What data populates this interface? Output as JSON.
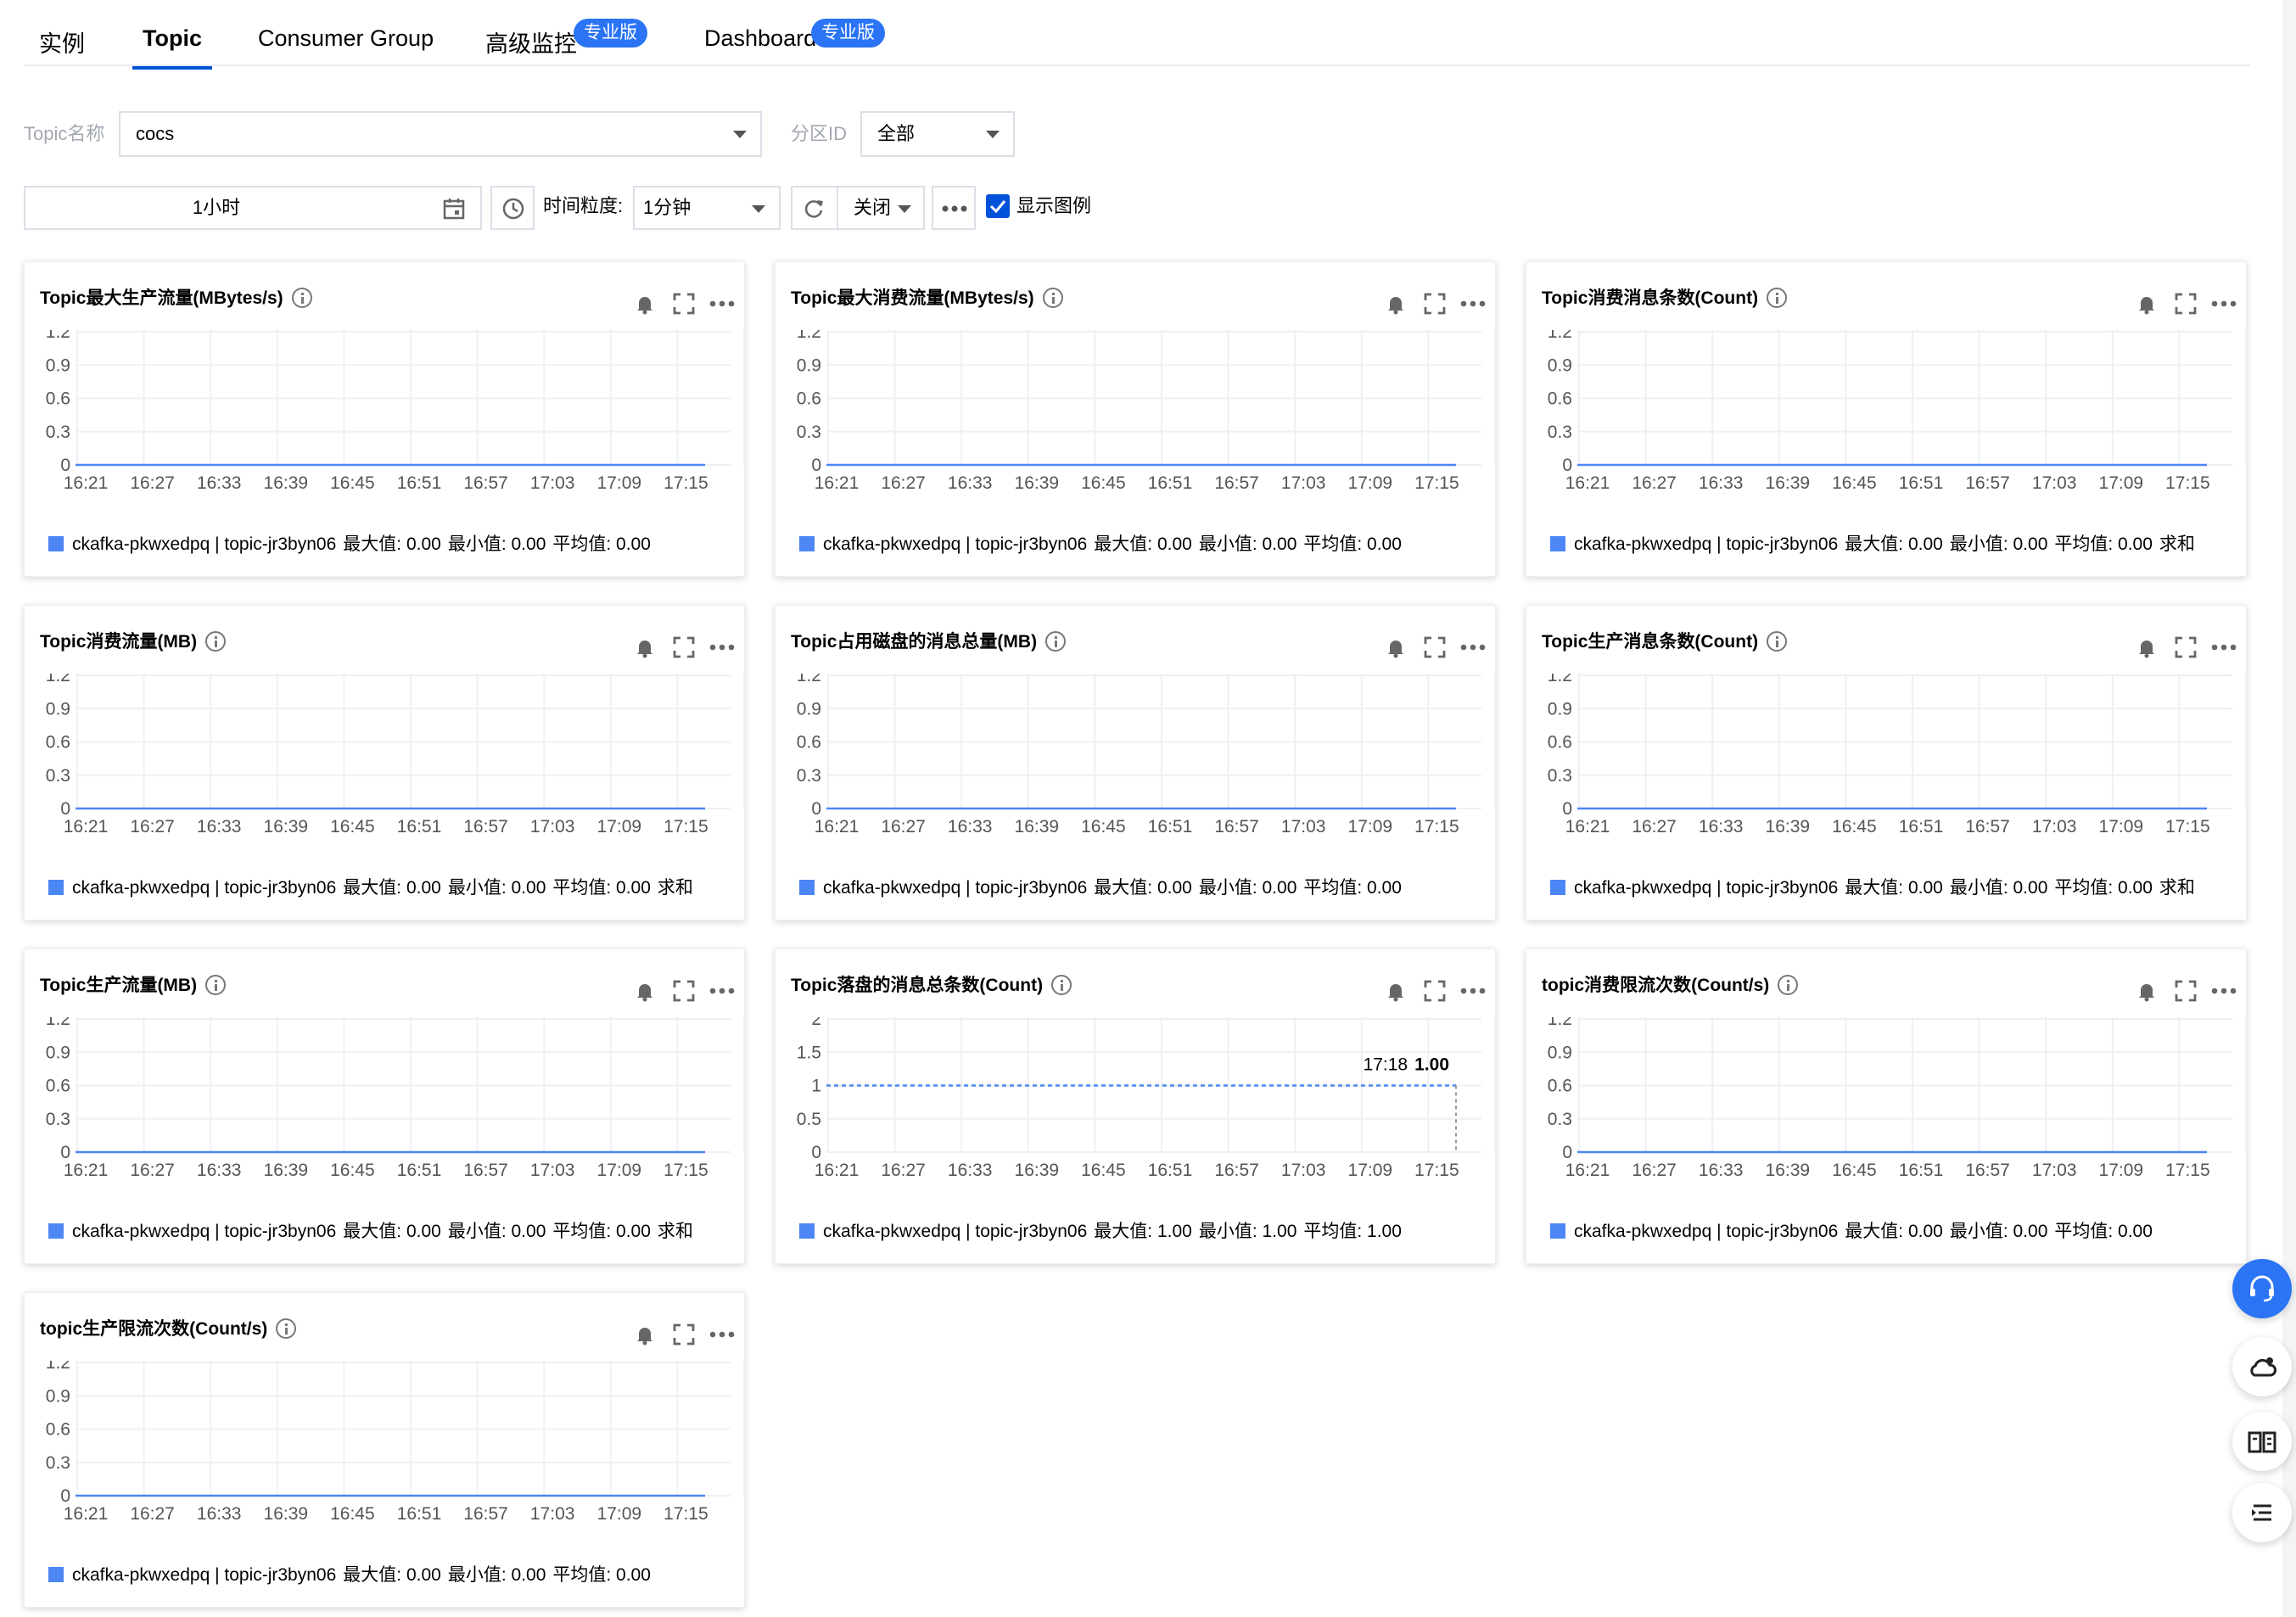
{
  "tabs": [
    {
      "label": "实例",
      "active": false
    },
    {
      "label": "Topic",
      "active": true
    },
    {
      "label": "Consumer Group",
      "active": false
    },
    {
      "label": "高级监控",
      "active": false,
      "badge": "专业版"
    },
    {
      "label": "Dashboard",
      "active": false,
      "badge": "专业版"
    }
  ],
  "filters": {
    "topic_label": "Topic名称",
    "topic_value": "cocs",
    "partition_label": "分区ID",
    "partition_value": "全部"
  },
  "toolbar": {
    "time_range": "1小时",
    "granularity_label": "时间粒度:",
    "granularity_value": "1分钟",
    "refresh_value": "关闭",
    "show_legend_label": "显示图例",
    "show_legend_checked": true
  },
  "accent_color": "#0052d9",
  "series_color": "#4d86f5",
  "icons": [
    "calendar-icon",
    "clock-icon",
    "refresh-icon",
    "more-icon",
    "bell-icon",
    "fullscreen-icon",
    "info-icon",
    "headset-icon",
    "cloud-icon",
    "book-icon",
    "list-icon"
  ],
  "chart_data": [
    {
      "type": "line",
      "title": "Topic最大生产流量(MBytes/s)",
      "x": [
        "16:21",
        "16:27",
        "16:33",
        "16:39",
        "16:45",
        "16:51",
        "16:57",
        "17:03",
        "17:09",
        "17:15"
      ],
      "yticks": [
        "1.2",
        "0.9",
        "0.6",
        "0.3",
        "0"
      ],
      "ylim": [
        0,
        1.2
      ],
      "series": [
        {
          "name": "ckafka-pkwxedpq | topic-jr3byn06",
          "values": [
            0,
            0,
            0,
            0,
            0,
            0,
            0,
            0,
            0,
            0,
            0
          ]
        }
      ],
      "legend": {
        "max": "最大值: 0.00",
        "min": "最小值: 0.00",
        "avg": "平均值: 0.00"
      }
    },
    {
      "type": "line",
      "title": "Topic最大消费流量(MBytes/s)",
      "x": [
        "16:21",
        "16:27",
        "16:33",
        "16:39",
        "16:45",
        "16:51",
        "16:57",
        "17:03",
        "17:09",
        "17:15"
      ],
      "yticks": [
        "1.2",
        "0.9",
        "0.6",
        "0.3",
        "0"
      ],
      "ylim": [
        0,
        1.2
      ],
      "series": [
        {
          "name": "ckafka-pkwxedpq | topic-jr3byn06",
          "values": [
            0,
            0,
            0,
            0,
            0,
            0,
            0,
            0,
            0,
            0,
            0
          ]
        }
      ],
      "legend": {
        "max": "最大值: 0.00",
        "min": "最小值: 0.00",
        "avg": "平均值: 0.00"
      }
    },
    {
      "type": "line",
      "title": "Topic消费消息条数(Count)",
      "x": [
        "16:21",
        "16:27",
        "16:33",
        "16:39",
        "16:45",
        "16:51",
        "16:57",
        "17:03",
        "17:09",
        "17:15"
      ],
      "yticks": [
        "1.2",
        "0.9",
        "0.6",
        "0.3",
        "0"
      ],
      "ylim": [
        0,
        1.2
      ],
      "series": [
        {
          "name": "ckafka-pkwxedpq | topic-jr3byn06",
          "values": [
            0,
            0,
            0,
            0,
            0,
            0,
            0,
            0,
            0,
            0,
            0
          ]
        }
      ],
      "legend": {
        "max": "最大值: 0.00",
        "min": "最小值: 0.00",
        "avg": "平均值: 0.00",
        "sum": "求和"
      }
    },
    {
      "type": "line",
      "title": "Topic消费流量(MB)",
      "x": [
        "16:21",
        "16:27",
        "16:33",
        "16:39",
        "16:45",
        "16:51",
        "16:57",
        "17:03",
        "17:09",
        "17:15"
      ],
      "yticks": [
        "1.2",
        "0.9",
        "0.6",
        "0.3",
        "0"
      ],
      "ylim": [
        0,
        1.2
      ],
      "series": [
        {
          "name": "ckafka-pkwxedpq | topic-jr3byn06",
          "values": [
            0,
            0,
            0,
            0,
            0,
            0,
            0,
            0,
            0,
            0,
            0
          ]
        }
      ],
      "legend": {
        "max": "最大值: 0.00",
        "min": "最小值: 0.00",
        "avg": "平均值: 0.00",
        "sum": "求和"
      }
    },
    {
      "type": "line",
      "title": "Topic占用磁盘的消息总量(MB)",
      "x": [
        "16:21",
        "16:27",
        "16:33",
        "16:39",
        "16:45",
        "16:51",
        "16:57",
        "17:03",
        "17:09",
        "17:15"
      ],
      "yticks": [
        "1.2",
        "0.9",
        "0.6",
        "0.3",
        "0"
      ],
      "ylim": [
        0,
        1.2
      ],
      "series": [
        {
          "name": "ckafka-pkwxedpq | topic-jr3byn06",
          "values": [
            0,
            0,
            0,
            0,
            0,
            0,
            0,
            0,
            0,
            0,
            0
          ]
        }
      ],
      "legend": {
        "max": "最大值: 0.00",
        "min": "最小值: 0.00",
        "avg": "平均值: 0.00"
      }
    },
    {
      "type": "line",
      "title": "Topic生产消息条数(Count)",
      "x": [
        "16:21",
        "16:27",
        "16:33",
        "16:39",
        "16:45",
        "16:51",
        "16:57",
        "17:03",
        "17:09",
        "17:15"
      ],
      "yticks": [
        "1.2",
        "0.9",
        "0.6",
        "0.3",
        "0"
      ],
      "ylim": [
        0,
        1.2
      ],
      "series": [
        {
          "name": "ckafka-pkwxedpq | topic-jr3byn06",
          "values": [
            0,
            0,
            0,
            0,
            0,
            0,
            0,
            0,
            0,
            0,
            0
          ]
        }
      ],
      "legend": {
        "max": "最大值: 0.00",
        "min": "最小值: 0.00",
        "avg": "平均值: 0.00",
        "sum": "求和"
      }
    },
    {
      "type": "line",
      "title": "Topic生产流量(MB)",
      "x": [
        "16:21",
        "16:27",
        "16:33",
        "16:39",
        "16:45",
        "16:51",
        "16:57",
        "17:03",
        "17:09",
        "17:15"
      ],
      "yticks": [
        "1.2",
        "0.9",
        "0.6",
        "0.3",
        "0"
      ],
      "ylim": [
        0,
        1.2
      ],
      "series": [
        {
          "name": "ckafka-pkwxedpq | topic-jr3byn06",
          "values": [
            0,
            0,
            0,
            0,
            0,
            0,
            0,
            0,
            0,
            0,
            0
          ]
        }
      ],
      "legend": {
        "max": "最大值: 0.00",
        "min": "最小值: 0.00",
        "avg": "平均值: 0.00",
        "sum": "求和"
      }
    },
    {
      "type": "line",
      "title": "Topic落盘的消息总条数(Count)",
      "x": [
        "16:21",
        "16:27",
        "16:33",
        "16:39",
        "16:45",
        "16:51",
        "16:57",
        "17:03",
        "17:09",
        "17:15"
      ],
      "yticks": [
        "2",
        "1.5",
        "1",
        "0.5",
        "0"
      ],
      "ylim": [
        0,
        2
      ],
      "series": [
        {
          "name": "ckafka-pkwxedpq | topic-jr3byn06",
          "values": [
            1,
            1,
            1,
            1,
            1,
            1,
            1,
            1,
            1,
            1,
            1
          ],
          "dashed": true
        }
      ],
      "tooltip": {
        "time": "17:18",
        "value": "1.00"
      },
      "legend": {
        "max": "最大值: 1.00",
        "min": "最小值: 1.00",
        "avg": "平均值: 1.00"
      }
    },
    {
      "type": "line",
      "title": "topic消费限流次数(Count/s)",
      "x": [
        "16:21",
        "16:27",
        "16:33",
        "16:39",
        "16:45",
        "16:51",
        "16:57",
        "17:03",
        "17:09",
        "17:15"
      ],
      "yticks": [
        "1.2",
        "0.9",
        "0.6",
        "0.3",
        "0"
      ],
      "ylim": [
        0,
        1.2
      ],
      "series": [
        {
          "name": "ckafka-pkwxedpq | topic-jr3byn06",
          "values": [
            0,
            0,
            0,
            0,
            0,
            0,
            0,
            0,
            0,
            0,
            0
          ]
        }
      ],
      "legend": {
        "max": "最大值: 0.00",
        "min": "最小值: 0.00",
        "avg": "平均值: 0.00"
      }
    },
    {
      "type": "line",
      "title": "topic生产限流次数(Count/s)",
      "x": [
        "16:21",
        "16:27",
        "16:33",
        "16:39",
        "16:45",
        "16:51",
        "16:57",
        "17:03",
        "17:09",
        "17:15"
      ],
      "yticks": [
        "1.2",
        "0.9",
        "0.6",
        "0.3",
        "0"
      ],
      "ylim": [
        0,
        1.2
      ],
      "series": [
        {
          "name": "ckafka-pkwxedpq | topic-jr3byn06",
          "values": [
            0,
            0,
            0,
            0,
            0,
            0,
            0,
            0,
            0,
            0,
            0
          ]
        }
      ],
      "legend": {
        "max": "最大值: 0.00",
        "min": "最小值: 0.00",
        "avg": "平均值: 0.00"
      }
    }
  ]
}
